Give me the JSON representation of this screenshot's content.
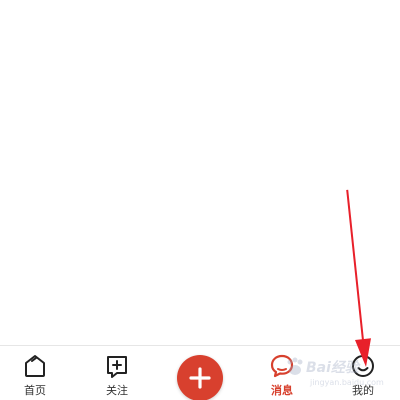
{
  "tabbar": {
    "home": {
      "label": "首页",
      "icon": "home-icon"
    },
    "follow": {
      "label": "关注",
      "icon": "follow-add-icon"
    },
    "publish": {
      "icon": "plus-icon"
    },
    "messages": {
      "label": "消息",
      "icon": "message-bubble-icon",
      "active": true
    },
    "mine": {
      "label": "我的",
      "icon": "smiley-profile-icon"
    }
  },
  "watermark": {
    "brand": "Bai经验",
    "url": "jingyan.baidu.com"
  },
  "colors": {
    "accent": "#d8402e",
    "active_label": "#d7402d",
    "inactive_label": "#333333",
    "arrow": "#e8202a"
  }
}
